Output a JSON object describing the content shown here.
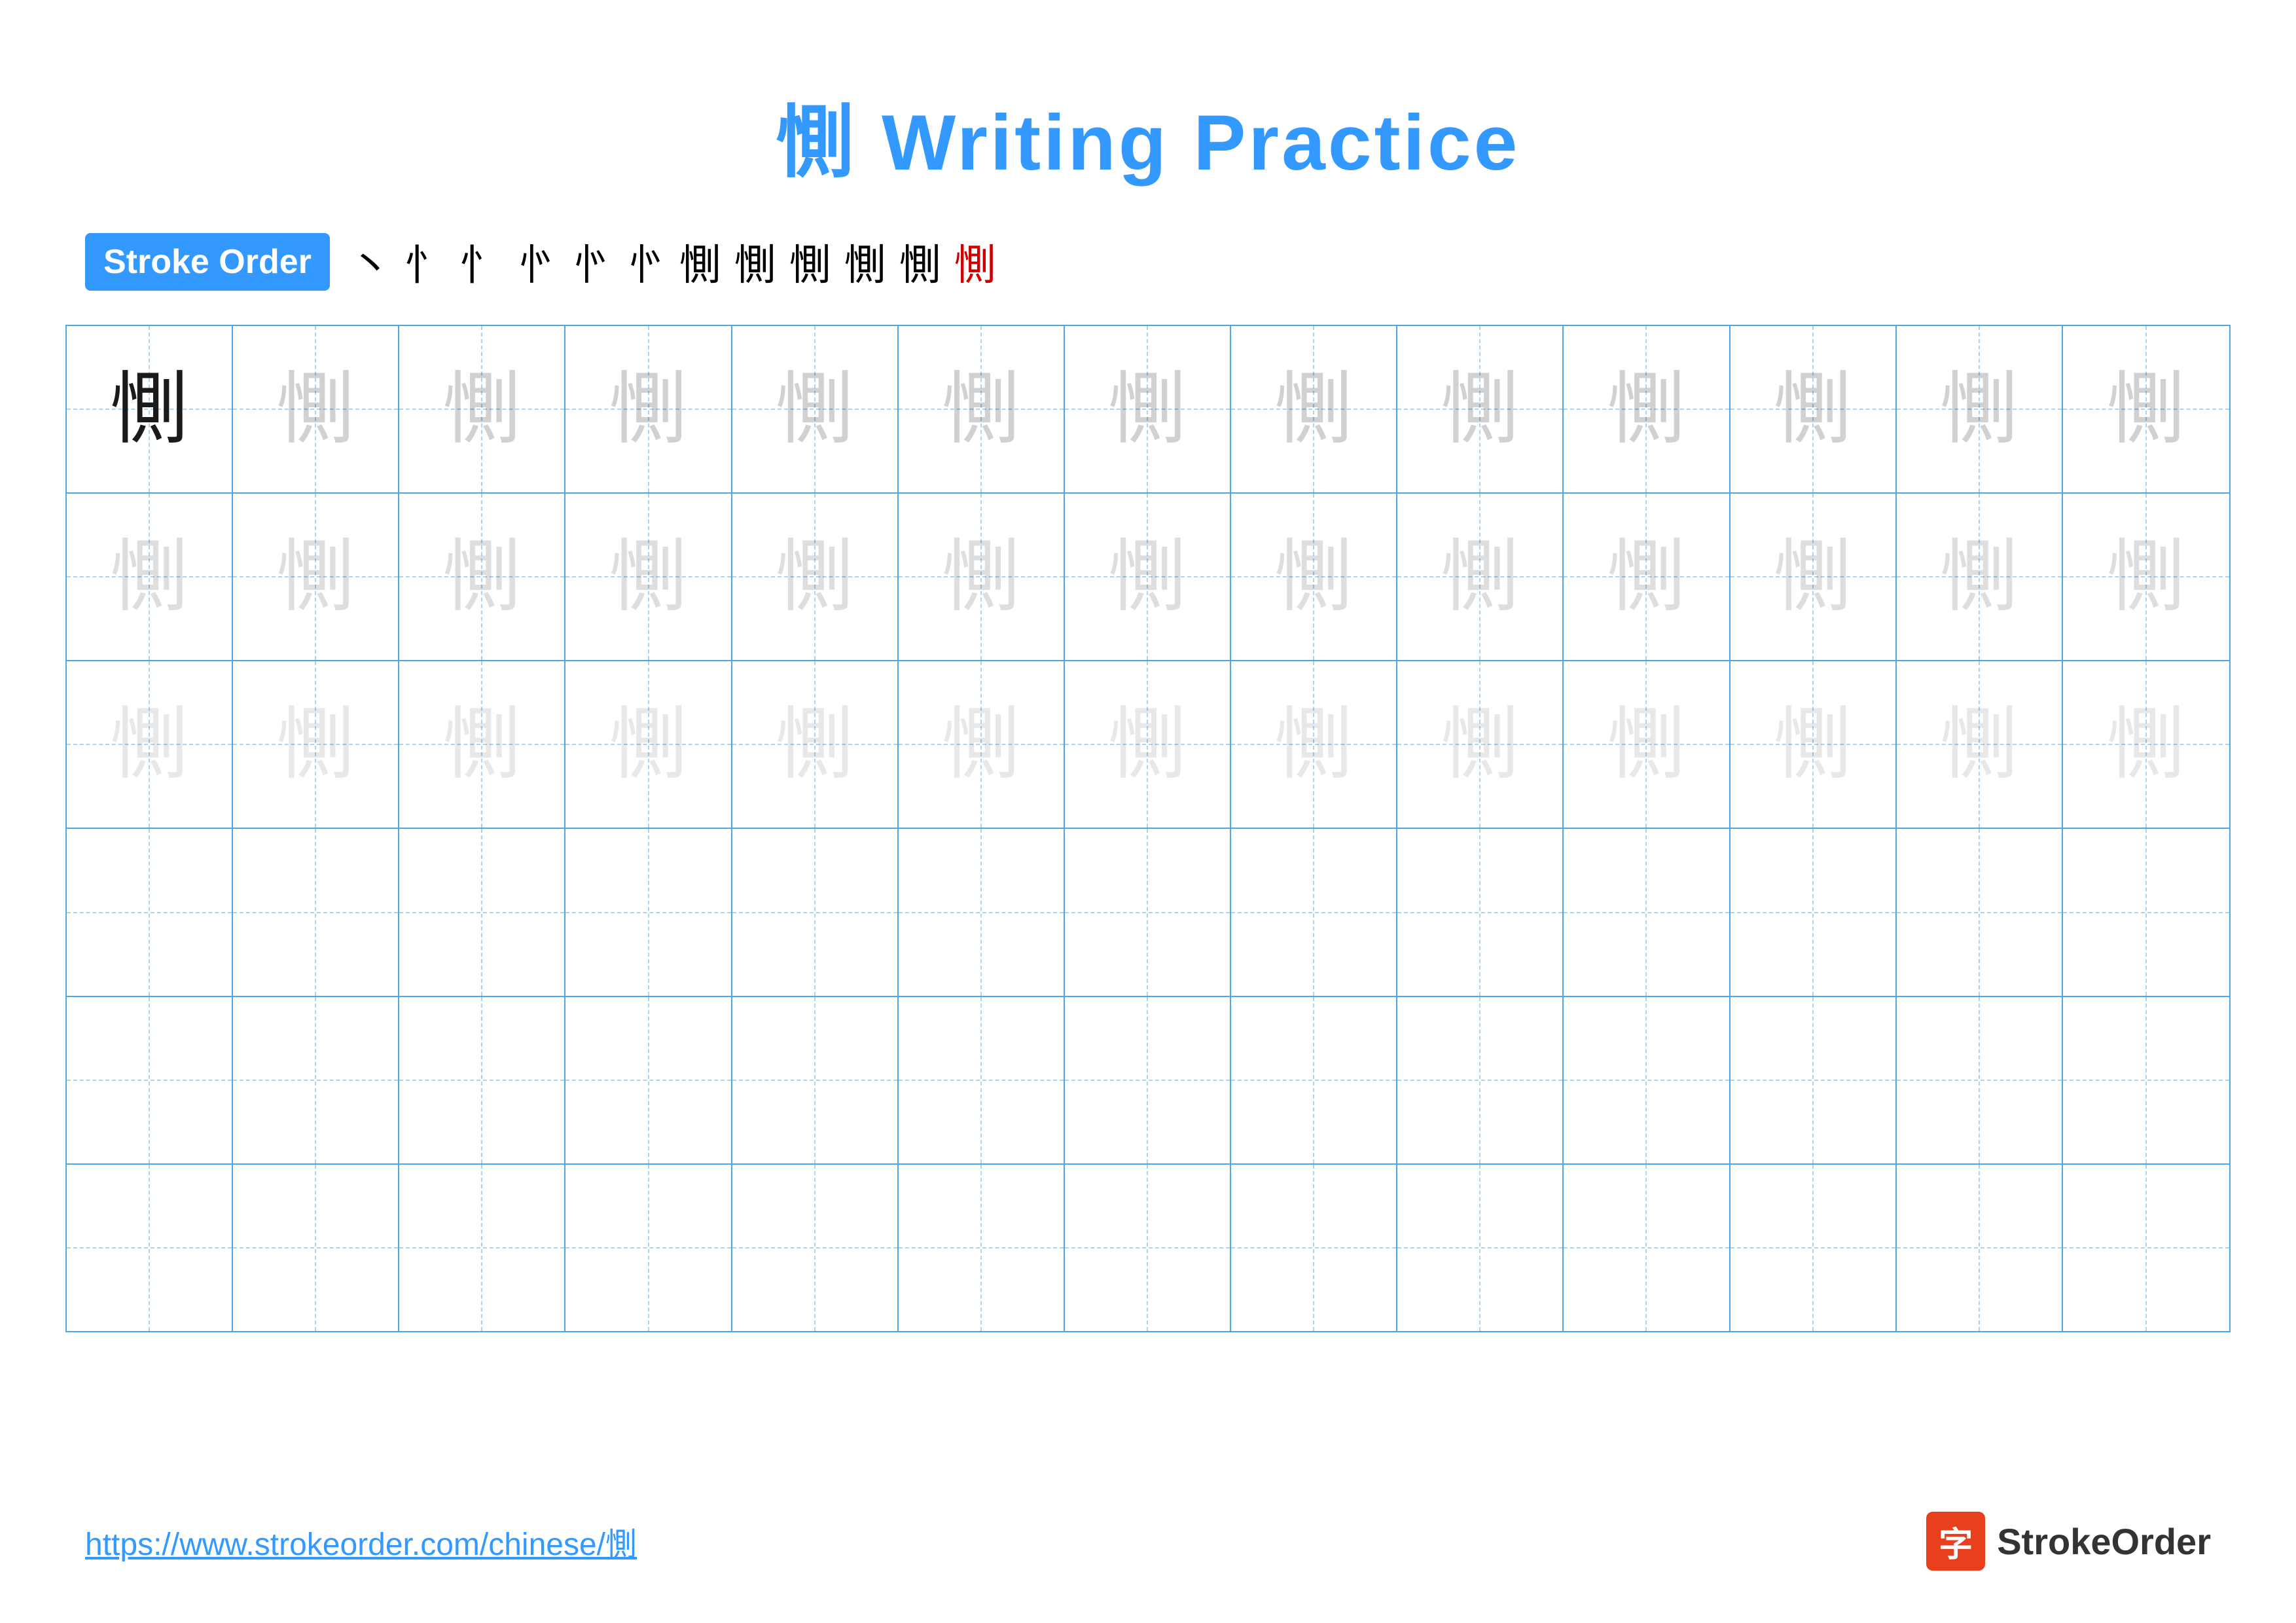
{
  "title": "惻 Writing Practice",
  "stroke_order": {
    "badge_label": "Stroke Order",
    "strokes": [
      "丶",
      "忄",
      "忄",
      "忄",
      "㣺",
      "㣺",
      "㣺",
      "惻",
      "惻",
      "惻",
      "惻",
      "惻"
    ]
  },
  "character": "惻",
  "grid": {
    "rows": 6,
    "cols": 13
  },
  "footer": {
    "url": "https://www.strokeorder.com/chinese/惻",
    "logo_text": "StrokeOrder",
    "logo_char": "字"
  }
}
